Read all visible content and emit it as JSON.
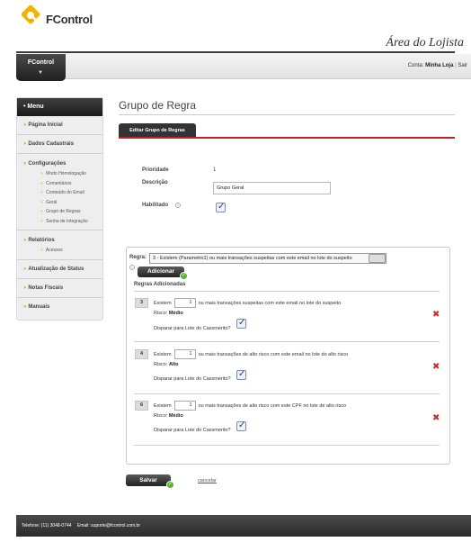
{
  "header": {
    "logo_text": "FControl",
    "area_title": "Área do Lojista",
    "brand_tab": "FControl",
    "store_label": "Conta:",
    "store_name": "Minha Loja",
    "store_extra": "Sair"
  },
  "sidebar": {
    "menu_title": "Menu",
    "items": [
      {
        "label": "Página Inicial"
      },
      {
        "label": "Dados Cadastrais"
      },
      {
        "label": "Configurações",
        "sub": [
          "Modo Homologação",
          "Comentários",
          "Conteúdo do Email",
          "Geral",
          "Grupo de Regras",
          "Senha de Integração"
        ]
      },
      {
        "label": "Relatórios",
        "sub": [
          "Acessos"
        ]
      },
      {
        "label": "Atualização de Status"
      },
      {
        "label": "Notas Fiscais"
      },
      {
        "label": "Manuais"
      }
    ]
  },
  "main": {
    "title": "Grupo de Regra",
    "tab": "Editar Grupo de Regras",
    "form": {
      "priority_label": "Prioridade",
      "priority_value": "1",
      "description_label": "Descrição",
      "description_value": "Grupo Geral",
      "enabled_label": "Habilitado",
      "help_icon": "?"
    },
    "rules": {
      "rule_label": "Regra:",
      "rule_select": "3 - Existem (Parametro1) ou mais transações suspeitas com este email no lote do suspeito",
      "add_button": "Adicionar",
      "added_label": "Regras Adicionadas",
      "list": [
        {
          "num": "3",
          "pre": "Existem",
          "value": "1",
          "post": "ou mais transações suspeitas com este email no lote do suspeito",
          "risk_label": "Risco:",
          "risk": "Médio",
          "disp": "Disparar para Lote do Cassmerito?"
        },
        {
          "num": "4",
          "pre": "Existem",
          "value": "1",
          "post": "ou mais transações de alto risco com este email no lote do alto risco",
          "risk_label": "Risco:",
          "risk": "Alto",
          "disp": "Disparar para Lote do Cassmerito?"
        },
        {
          "num": "6",
          "pre": "Existem",
          "value": "1",
          "post": "ou mais transações de alto risco com este CPF no lote de alto risco",
          "risk_label": "Risco:",
          "risk": "Médio",
          "disp": "Disparar para Lote do Cassmerito?"
        }
      ]
    },
    "save_button": "Salvar",
    "cancel_link": "cancelar"
  },
  "footer": {
    "phone": "Telefone: (11) 3048-0744",
    "email": "Email: suporte@fcontrol.com.br"
  },
  "colors": {
    "accent": "#c02020",
    "bullet": "#e6a600",
    "delete": "#c92a2a",
    "ok": "#59b32c"
  }
}
